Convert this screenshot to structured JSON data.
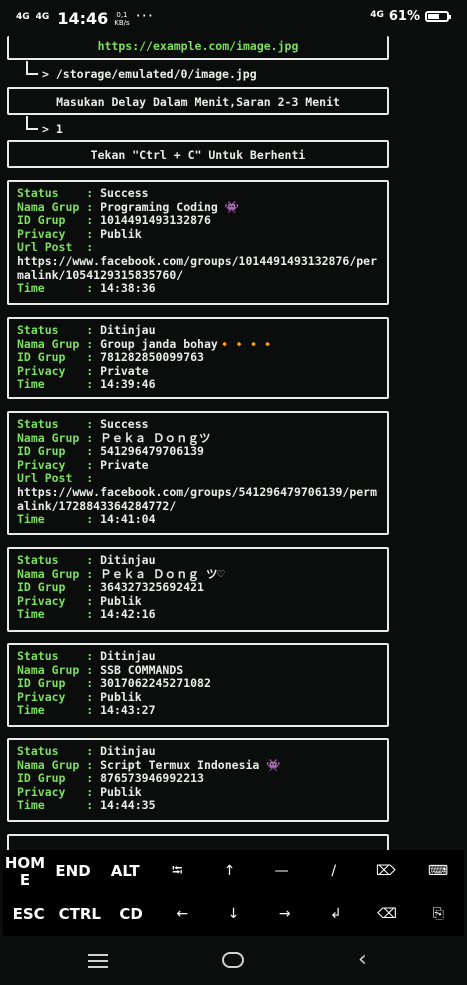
{
  "statusbar": {
    "sig1": "4G",
    "sig2": "4G",
    "time": "14:46",
    "speed_value": "0,1",
    "speed_unit": "KB/s",
    "more": "···",
    "right_sig": "4G",
    "battery": "61%",
    "battery_level": 0.61
  },
  "terminal": {
    "top_url": "https://example.com/image.jpg",
    "save_path": "/storage/emulated/0/image.jpg",
    "delay_prompt": "Masukan Delay Dalam Menit,Saran 2-3 Menit",
    "delay_value": "1",
    "stop_hint": "Tekan \"Ctrl + C\" Untuk Berhenti",
    "arrow_glyph": ">",
    "records": [
      {
        "status_key": "Status    :",
        "status": "Success",
        "name_key": "Nama Grup :",
        "name": "Programing Coding 👾",
        "id_key": "ID Grup   :",
        "id": "1014491493132876",
        "privacy_key": "Privacy   :",
        "privacy": "Publik",
        "url_key": "Url Post  :",
        "url": "https://www.facebook.com/groups/1014491493132876/permalink/1054129315835760/",
        "time_key": "Time      :",
        "time": "14:38:36"
      },
      {
        "status_key": "Status    :",
        "status": "Ditinjau",
        "name_key": "Nama Grup :",
        "name": "Group janda bohay🔸🔸🔸🔸",
        "id_key": "ID Grup   :",
        "id": "781282850099763",
        "privacy_key": "Privacy   :",
        "privacy": "Private",
        "time_key": "Time      :",
        "time": "14:39:46"
      },
      {
        "status_key": "Status    :",
        "status": "Success",
        "name_key": "Nama Grup :",
        "name": "Ｐｅｋａ Ｄｏｎｇツ",
        "id_key": "ID Grup   :",
        "id": "541296479706139",
        "privacy_key": "Privacy   :",
        "privacy": "Private",
        "url_key": "Url Post  :",
        "url": "https://www.facebook.com/groups/541296479706139/permalink/1728843364284772/",
        "time_key": "Time      :",
        "time": "14:41:04"
      },
      {
        "status_key": "Status    :",
        "status": "Ditinjau",
        "name_key": "Nama Grup :",
        "name": "Ｐｅｋａ Ｄｏｎｇ ツ♡",
        "id_key": "ID Grup   :",
        "id": "364327325692421",
        "privacy_key": "Privacy   :",
        "privacy": "Publik",
        "time_key": "Time      :",
        "time": "14:42:16"
      },
      {
        "status_key": "Status    :",
        "status": "Ditinjau",
        "name_key": "Nama Grup :",
        "name": "SSB COMMANDS",
        "id_key": "ID Grup   :",
        "id": "3017062245271082",
        "privacy_key": "Privacy   :",
        "privacy": "Publik",
        "time_key": "Time      :",
        "time": "14:43:27"
      },
      {
        "status_key": "Status    :",
        "status": "Ditinjau",
        "name_key": "Nama Grup :",
        "name": "Script Termux Indonesia 👾",
        "id_key": "ID Grup   :",
        "id": "876573946992213",
        "privacy_key": "Privacy   :",
        "privacy": "Publik",
        "time_key": "Time      :",
        "time": "14:44:35"
      }
    ]
  },
  "keys": {
    "home": "HOME",
    "end": "END",
    "alt": "ALT",
    "tab": "⭾",
    "up": "↑",
    "dash": "—",
    "slash": "/",
    "delete": "⌦",
    "keyboard": "⌨",
    "esc": "ESC",
    "ctrl": "CTRL",
    "cd": "CD",
    "left": "←",
    "down": "↓",
    "right": "→",
    "enter": "↲",
    "backspace": "⌫",
    "paste": "⎘"
  },
  "colors": {
    "accent_green": "#7dde61",
    "background": "#0b0d0c",
    "text": "#e9ece8"
  }
}
